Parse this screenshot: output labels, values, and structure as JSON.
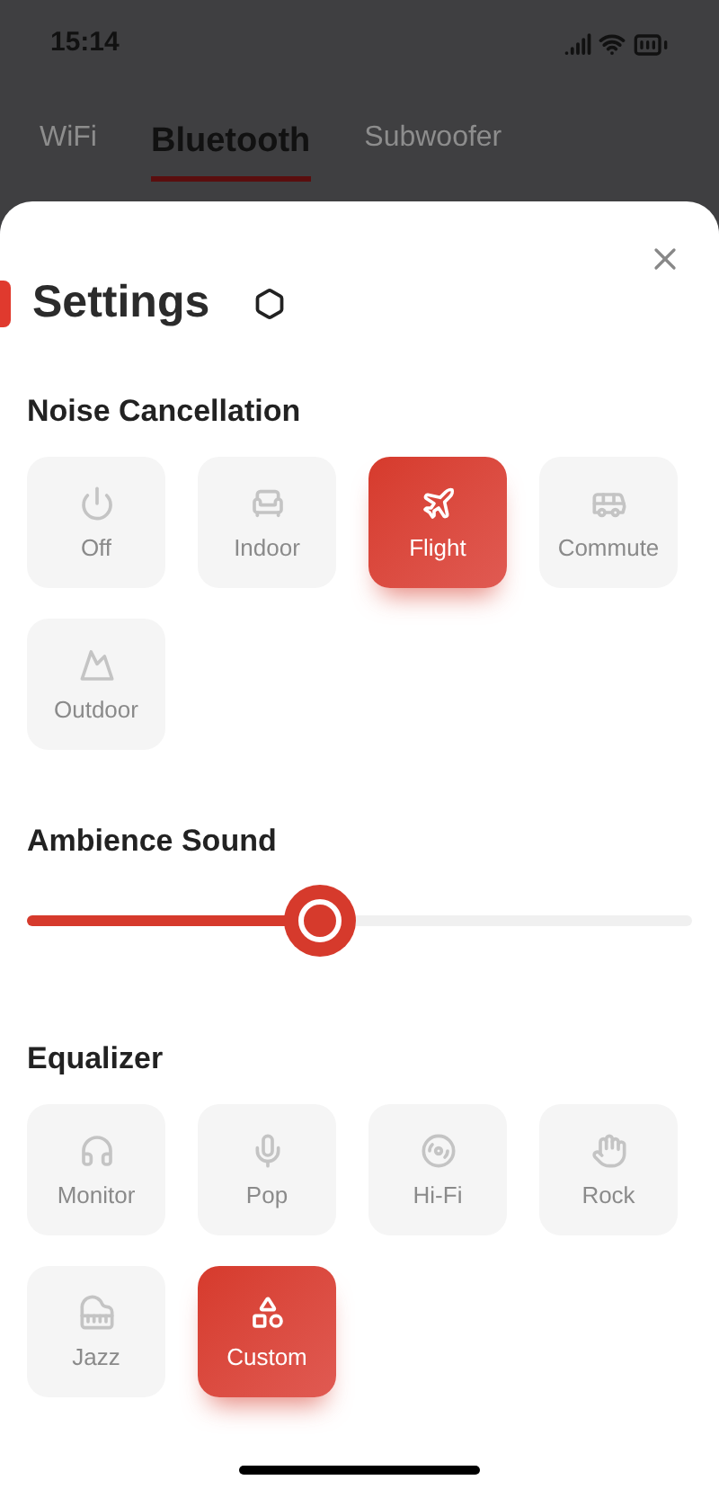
{
  "status_bar": {
    "time": "15:14"
  },
  "tabs": [
    {
      "label": "WiFi",
      "selected": false
    },
    {
      "label": "Bluetooth",
      "selected": true
    },
    {
      "label": "Subwoofer",
      "selected": false
    }
  ],
  "sheet": {
    "title": "Settings",
    "noise_cancellation": {
      "label": "Noise Cancellation",
      "options": [
        {
          "label": "Off",
          "selected": false
        },
        {
          "label": "Indoor",
          "selected": false
        },
        {
          "label": "Flight",
          "selected": true
        },
        {
          "label": "Commute",
          "selected": false
        },
        {
          "label": "Outdoor",
          "selected": false
        }
      ]
    },
    "ambience_sound": {
      "label": "Ambience Sound",
      "level": 0.44
    },
    "equalizer": {
      "label": "Equalizer",
      "options": [
        {
          "label": "Monitor",
          "selected": false
        },
        {
          "label": "Pop",
          "selected": false
        },
        {
          "label": "Hi-Fi",
          "selected": false
        },
        {
          "label": "Rock",
          "selected": false
        },
        {
          "label": "Jazz",
          "selected": false
        },
        {
          "label": "Custom",
          "selected": true
        }
      ]
    }
  }
}
